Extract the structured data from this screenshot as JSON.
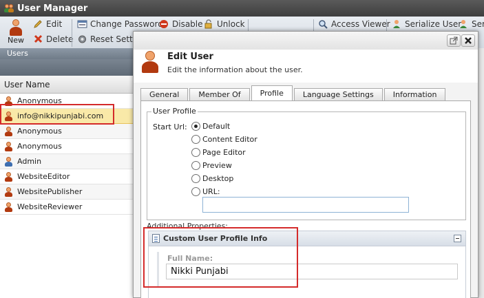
{
  "window": {
    "title": "User Manager"
  },
  "ribbon": {
    "new_label": "New",
    "edit_label": "Edit",
    "delete_label": "Delete",
    "change_password_label": "Change Password",
    "reset_settings_label": "Reset Settin",
    "disable_label": "Disable",
    "unlock_label": "Unlock",
    "access_viewer_label": "Access Viewer",
    "serialize_user_label": "Serialize User",
    "serialize_more_label": "Seriali",
    "group_label": "Users"
  },
  "grid": {
    "column_header": "User Name",
    "rows": [
      {
        "name": "Anonymous"
      },
      {
        "name": "info@nikkipunjabi.com"
      },
      {
        "name": "Anonymous"
      },
      {
        "name": "Anonymous"
      },
      {
        "name": "Admin"
      },
      {
        "name": "WebsiteEditor"
      },
      {
        "name": "WebsitePublisher"
      },
      {
        "name": "WebsiteReviewer"
      }
    ]
  },
  "dialog": {
    "title": "Edit User",
    "subtitle": "Edit the information about the user.",
    "tabs": [
      "General",
      "Member Of",
      "Profile",
      "Language Settings",
      "Information"
    ],
    "active_tab": "Profile",
    "profile": {
      "legend": "User Profile",
      "start_url_label": "Start Url:",
      "options": [
        "Default",
        "Content Editor",
        "Page Editor",
        "Preview",
        "Desktop",
        "URL:"
      ],
      "selected_option": "Default",
      "url_value": ""
    },
    "additional_properties_label": "Additional Properties:",
    "custom_panel": {
      "title": "Custom User Profile Info",
      "full_name_label": "Full Name:",
      "full_name_value": "Nikki Punjabi"
    }
  },
  "colors": {
    "highlight_red": "#d42a2a",
    "selected_row": "#f9e9a8",
    "ribbon_group": "#6f7b88"
  }
}
